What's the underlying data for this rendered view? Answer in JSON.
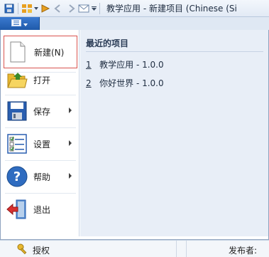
{
  "window": {
    "title": "教学应用 - 新建项目 (Chinese (Si"
  },
  "quick_access_toolbar": {
    "icons": [
      "save-icon",
      "app-icon",
      "dropdown-arrow-icon",
      "debug-icon",
      "back-icon",
      "forward-icon",
      "mail-icon",
      "customize-icon"
    ]
  },
  "app_button": {
    "icon": "document-menu-icon"
  },
  "menu": {
    "items": [
      {
        "label": "新建(N)",
        "icon": "new-document-icon",
        "has_submenu": false,
        "selected": true
      },
      {
        "label": "打开",
        "icon": "open-folder-icon",
        "has_submenu": false
      },
      {
        "label": "保存",
        "icon": "save-disk-icon",
        "has_submenu": true
      },
      {
        "label": "设置",
        "icon": "settings-checklist-icon",
        "has_submenu": true
      },
      {
        "label": "帮助",
        "icon": "help-icon",
        "has_submenu": true
      },
      {
        "label": "退出",
        "icon": "exit-icon",
        "has_submenu": false
      }
    ]
  },
  "recent": {
    "title": "最近的项目",
    "items": [
      {
        "index": "1",
        "name": "教学应用 - 1.0.0"
      },
      {
        "index": "2",
        "name": "你好世界 - 1.0.0"
      }
    ]
  },
  "background": {
    "auth_label": "授权",
    "publisher_label": "发布者:"
  },
  "colors": {
    "accent": "#2563b5",
    "selection_border": "#d9534f",
    "recent_panel": "#e8eef7"
  }
}
